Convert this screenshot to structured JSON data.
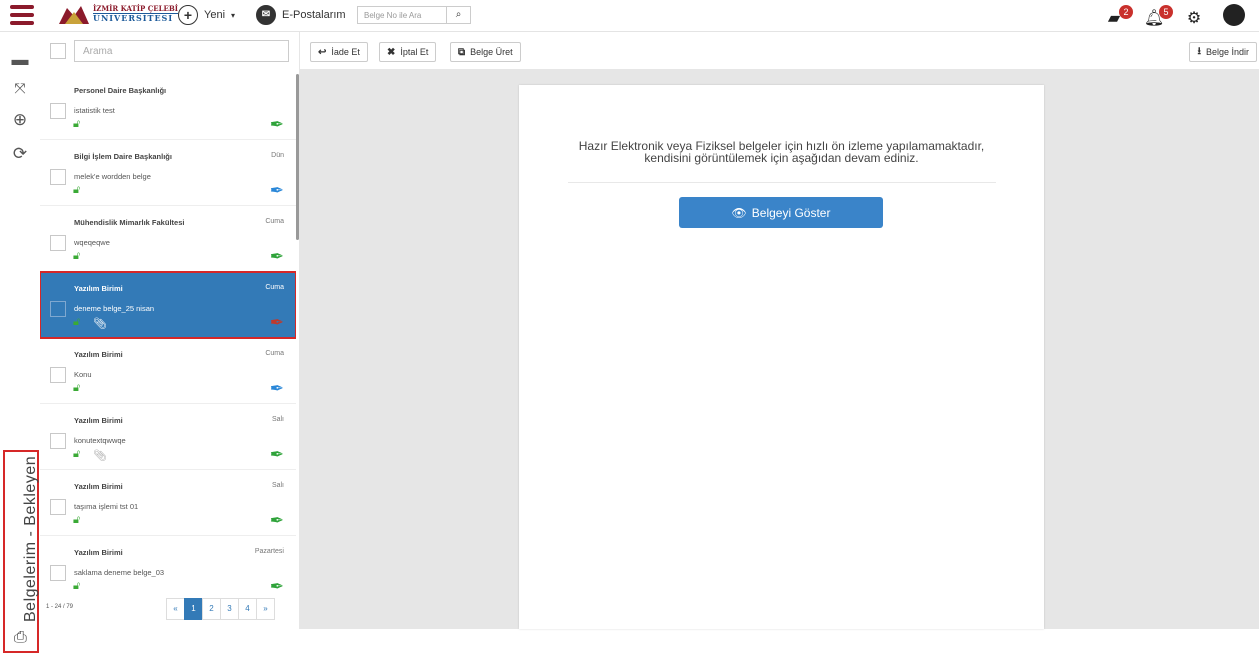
{
  "header": {
    "logo_line1": "İZMİR KATİP ÇELEBİ",
    "logo_line2": "ÜNİVERSİTESİ",
    "new_label": "Yeni",
    "email_label": "E-Postalarım",
    "doc_search_placeholder": "Belge No ile Ara",
    "inbox_badge": "2",
    "notif_badge": "5"
  },
  "rail": {
    "vertical_label": "Belgelerim - Bekleyen"
  },
  "list": {
    "search_placeholder": "Arama",
    "items": [
      {
        "dept": "Personel Daire Başkanlığı",
        "day": "",
        "subject": "istatistik test",
        "pen": "green",
        "clip": false
      },
      {
        "dept": "Bilgi İşlem Daire Başkanlığı",
        "day": "Dün",
        "subject": "melek'e wordden belge",
        "pen": "blue",
        "clip": false
      },
      {
        "dept": "Mühendislik Mimarlık Fakültesi",
        "day": "Cuma",
        "subject": "wqeqeqwe",
        "pen": "green",
        "clip": false
      },
      {
        "dept": "Yazılım Birimi",
        "day": "Cuma",
        "subject": "deneme belge_25 nisan",
        "pen": "red",
        "clip": true
      },
      {
        "dept": "Yazılım Birimi",
        "day": "Cuma",
        "subject": "Konu",
        "pen": "blue",
        "clip": false
      },
      {
        "dept": "Yazılım Birimi",
        "day": "Salı",
        "subject": "konutextqwwqe",
        "pen": "green",
        "clip": true
      },
      {
        "dept": "Yazılım Birimi",
        "day": "Salı",
        "subject": "taşıma işlemi tst 01",
        "pen": "green",
        "clip": false
      },
      {
        "dept": "Yazılım Birimi",
        "day": "Pazartesi",
        "subject": "saklama deneme belge_03",
        "pen": "green",
        "clip": false
      }
    ],
    "count_text": "1 - 24 / 79",
    "pager": {
      "prev": "«",
      "pages": [
        "1",
        "2",
        "3",
        "4"
      ],
      "next": "»",
      "active": "1"
    }
  },
  "toolbar": {
    "return_label": "İade Et",
    "cancel_label": "İptal Et",
    "generate_label": "Belge Üret",
    "download_label": "Belge İndir"
  },
  "preview": {
    "message_line1": "Hazır Elektronik veya Fiziksel belgeler için hızlı ön izleme yapılamamaktadır,",
    "message_line2": "kendisini görüntülemek için aşağıdan devam ediniz.",
    "show_button": "Belgeyi Göster"
  },
  "colors": {
    "brand": "#8b1a2b",
    "primary": "#337ab7",
    "highlight_border": "#d62828",
    "pen_green": "#2fa33a",
    "pen_blue": "#2a87d8",
    "pen_red": "#c0392b"
  }
}
